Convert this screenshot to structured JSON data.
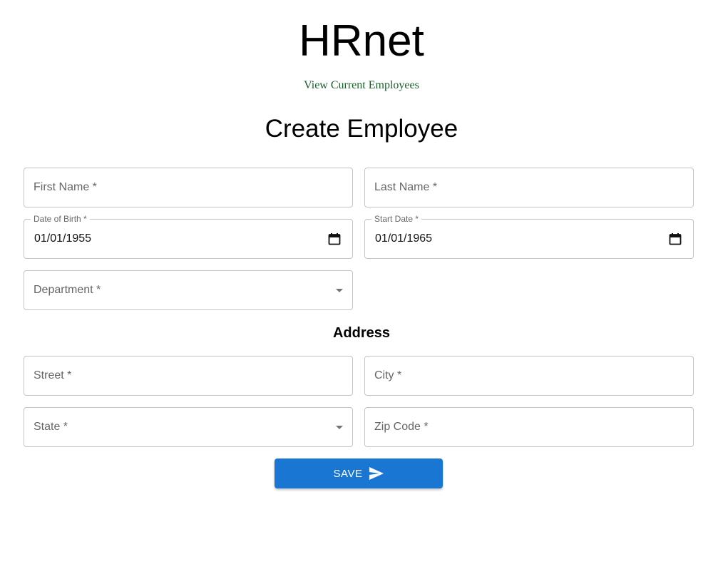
{
  "header": {
    "app_title": "HRnet",
    "nav_link": "View Current Employees"
  },
  "form": {
    "title": "Create Employee",
    "first_name": {
      "label": "First Name *",
      "value": ""
    },
    "last_name": {
      "label": "Last Name *",
      "value": ""
    },
    "date_of_birth": {
      "label": "Date of Birth *",
      "value": "01/01/1955",
      "icon": "calendar-icon"
    },
    "start_date": {
      "label": "Start Date *",
      "value": "01/01/1965",
      "icon": "calendar-icon"
    },
    "department": {
      "label": "Department *",
      "value": "",
      "icon": "dropdown-arrow-icon"
    },
    "address_section": "Address",
    "street": {
      "label": "Street *",
      "value": ""
    },
    "city": {
      "label": "City *",
      "value": ""
    },
    "state": {
      "label": "State *",
      "value": "",
      "icon": "dropdown-arrow-icon"
    },
    "zip_code": {
      "label": "Zip Code *",
      "value": ""
    },
    "save_button": {
      "label": "SAVE",
      "icon": "send-icon"
    }
  },
  "colors": {
    "primary": "#1976d2",
    "link": "#1a5e2a",
    "border": "#c4c4c4",
    "placeholder": "#666666"
  }
}
